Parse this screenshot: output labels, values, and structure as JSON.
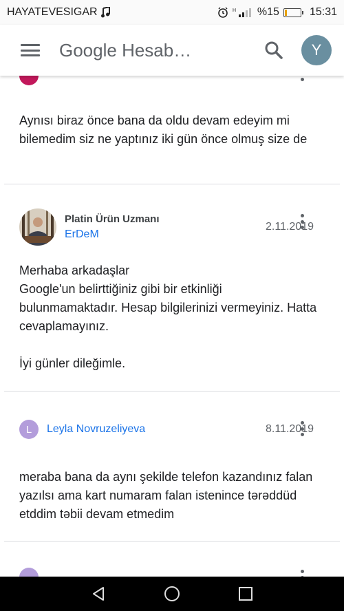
{
  "status_bar": {
    "carrier": "HAYATEVESIGAR",
    "music_icon": "music-note-icon",
    "battery_percent": "%15",
    "battery_level": 0.15,
    "time": "15:31"
  },
  "app_bar": {
    "title": "Google Hesab…",
    "avatar_letter": "Y",
    "avatar_color": "#6a8fa0"
  },
  "posts": [
    {
      "body": "Aynısı biraz önce bana da oldu devam edeyim mi bilemedim siz ne yaptınız iki gün önce olmuş size de"
    },
    {
      "badge": "Platin Ürün Uzmanı",
      "author": "ErDeM",
      "date": "2.11.2019",
      "body": "Merhaba arkadaşlar\nGoogle'un belirttiğiniz gibi bir etkinliği bulunmamaktadır.  Hesap bilgilerinizi vermeyiniz. Hatta cevaplamayınız.\n\nİyi günler dileğimle."
    },
    {
      "avatar_letter": "L",
      "author": "Leyla Novruzeliyeva",
      "date": "8.11.2019",
      "body": "meraba bana da aynı şekilde telefon kazandınız falan yazılsı ama kart numaram falan istenince tərəddüd etddim təbii devam etmedim"
    }
  ],
  "colors": {
    "link": "#1a73e8",
    "letter_avatar": "#b39ddb"
  }
}
